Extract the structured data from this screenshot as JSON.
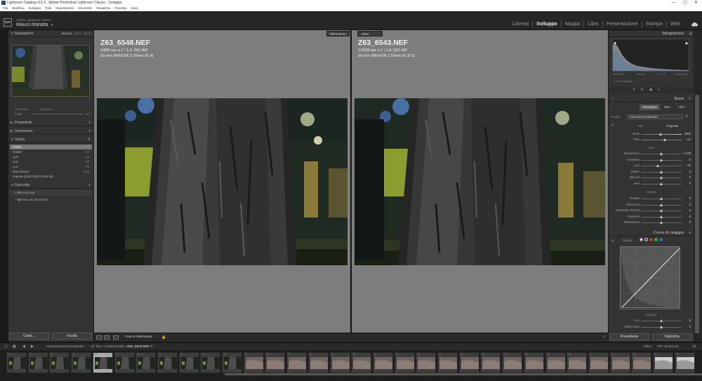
{
  "window": {
    "title": "Lightroom Catalog-v13-3 - Adobe Photoshop Lightroom Classic - Sviluppo",
    "controls": [
      "—",
      "▢",
      "✕"
    ]
  },
  "menu": [
    "File",
    "Modifica",
    "Sviluppo",
    "Foto",
    "Impostazioni",
    "Strumenti",
    "Visualizza",
    "Finestra",
    "Aiuto"
  ],
  "identity": {
    "logo": "Lrc",
    "sub": "Adobe Lightroom Classic",
    "name": "Mauro Maratta"
  },
  "modules": {
    "items": [
      "Libreria",
      "Sviluppo",
      "Mappa",
      "Libro",
      "Presentazione",
      "Stampa",
      "Web"
    ],
    "active": "Sviluppo"
  },
  "left": {
    "navigator": {
      "title": "Navigatore",
      "zooms": [
        "ADATTA",
        "100%",
        "300%"
      ]
    },
    "presets_bar": {
      "left": "Predefinito",
      "right": "Nessuno",
      "amount_label": "Entità",
      "amount_value": "100"
    },
    "presets": "Predefiniti",
    "snapshots": "Istantanee",
    "history": {
      "title": "Storia",
      "rows": [
        {
          "label": "Ombre",
          "value": "-34",
          "sel": true
        },
        {
          "label": "Ombre",
          "value": "-19"
        },
        {
          "label": "Luci",
          "value": "-23"
        },
        {
          "label": "Luci",
          "value": "-29"
        },
        {
          "label": "Luci",
          "value": "-28"
        },
        {
          "label": "Esposizione",
          "value": "-0,09"
        },
        {
          "label": "Importa (11/07/2024 16:54:35)",
          "value": ""
        }
      ]
    },
    "collections": {
      "title": "Raccolte",
      "filter": "Filtra raccolte",
      "smart": "Raccolte dinamiche"
    },
    "copy": "Copia...",
    "paste": "Incolla"
  },
  "center": {
    "left_label": "Riferimento",
    "right_label": "Attivo",
    "left": {
      "name": "Z63_6548.NEF",
      "exposure": "1/800 sec a ƒ / 1,4, ISO 400",
      "lens": "50 mm (NIKKOR Z 50mm f/1.4)"
    },
    "right": {
      "name": "Z63_6543.NEF",
      "exposure": "1/1000 sec a ƒ / 1,8, ISO 400",
      "lens": "50 mm (NIKKOR Z 50mm f/1.8 S)"
    },
    "toolbar_label": "Foto di riferimento"
  },
  "right": {
    "histogram": {
      "title": "Istogramma",
      "iso": "ISO 400",
      "focal": "50 mm",
      "aperture": "ƒ / 1,8",
      "shutter": "1/1000 sec",
      "original": "Foto originale"
    },
    "basic": {
      "title": "Base",
      "modes": [
        "Automatico",
        "B&N",
        "HDR"
      ],
      "profile_label": "Profilo",
      "profile_value": "Fotocamera standard",
      "wb_label": "WB",
      "wb_value": "Originale",
      "sliders_top": [
        {
          "label": "Temp",
          "value": "4950",
          "pos": 0.45
        },
        {
          "label": "Tinta",
          "value": "+14",
          "pos": 0.55
        }
      ],
      "tone_label": "Tono",
      "sliders_tone": [
        {
          "label": "Esposizione",
          "value": "+ 0,00",
          "pos": 0.5
        },
        {
          "label": "Contrasto",
          "value": "0",
          "pos": 0.5
        },
        {
          "label": "Luci",
          "value": "-18",
          "pos": 0.42
        },
        {
          "label": "Ombre",
          "value": "0",
          "pos": 0.5
        },
        {
          "label": "Bianchi",
          "value": "0",
          "pos": 0.5
        },
        {
          "label": "Neri",
          "value": "0",
          "pos": 0.5
        }
      ],
      "presence_label": "Impatto",
      "sliders_presence": [
        {
          "label": "Texture",
          "value": "0",
          "pos": 0.5
        },
        {
          "label": "Chiarezza",
          "value": "0",
          "pos": 0.5
        },
        {
          "label": "Rimozione foschia",
          "value": "0",
          "pos": 0.5
        },
        {
          "label": "Vividezza",
          "value": "0",
          "pos": 0.5
        },
        {
          "label": "Saturazione",
          "value": "0",
          "pos": 0.5
        }
      ]
    },
    "curve": {
      "title": "Curva di viraggio",
      "adjust": "Regola",
      "region": "Regione",
      "sliders": [
        {
          "label": "Luci",
          "value": "0",
          "pos": 0.5
        },
        {
          "label": "Colori chiari",
          "value": "0",
          "pos": 0.5
        }
      ]
    },
    "previous": "Precedente",
    "reset": "Ripristina"
  },
  "filmstrip": {
    "source": "Importazione precedente",
    "count": "47 foto / 1 selezionato /",
    "filename": "Z63_6543.NEF",
    "filter_label": "Filtro:",
    "filter_value": "Filtri disattivati",
    "numbers": [
      "14",
      "15",
      "16",
      "17",
      "18",
      "19",
      "20",
      "21",
      "22",
      "23",
      "24",
      "25",
      "26",
      "27",
      "28",
      "29",
      "30",
      "31",
      "32",
      "33",
      "34",
      "35",
      "36",
      "37",
      "38",
      "39",
      "40",
      "41",
      "42",
      "43",
      "44",
      "45"
    ],
    "selected_index": 4
  },
  "colors": {
    "accent": "#4a7fb5",
    "panel": "#333333",
    "bg": "#1a1a1a",
    "workspace": "#7d7d7d"
  }
}
